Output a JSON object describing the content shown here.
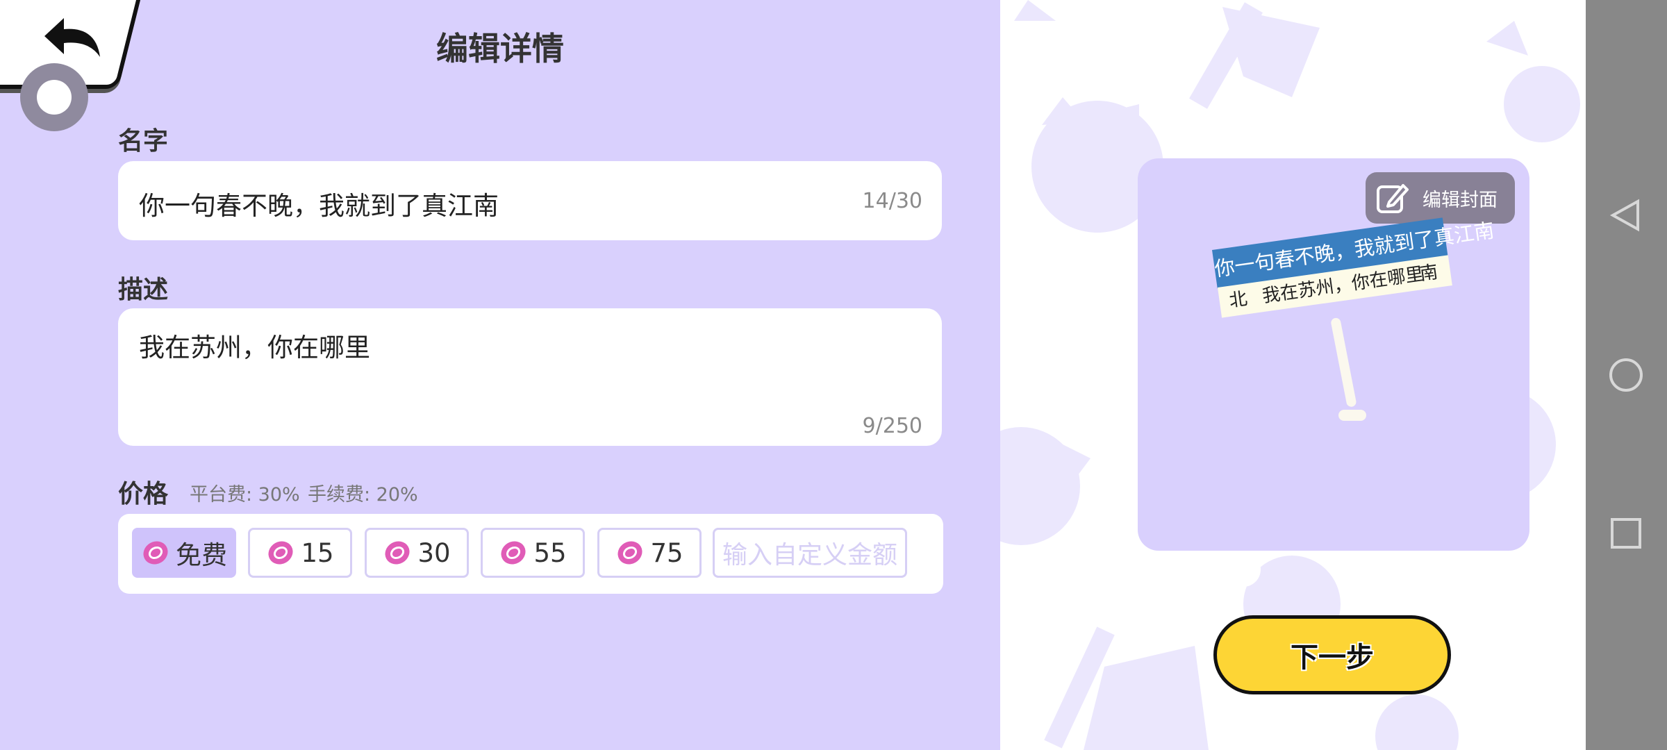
{
  "header": {
    "title": "编辑详情"
  },
  "name_field": {
    "label": "名字",
    "value": "你一句春不晚，我就到了真江南",
    "counter": "14/30"
  },
  "description_field": {
    "label": "描述",
    "value": "我在苏州，你在哪里",
    "counter": "9/250"
  },
  "price": {
    "label": "价格",
    "platform_fee": "平台费: 30%",
    "handling_fee": "手续费: 20%",
    "options": [
      "免费",
      "15",
      "30",
      "55",
      "75"
    ],
    "selected_index": 0,
    "custom_placeholder": "输入自定义金额"
  },
  "cover": {
    "edit_label": "编辑封面",
    "sign_title": "你一句春不晚，我就到了真江南",
    "sign_left": "北",
    "sign_center": "我在苏州，你在哪里",
    "sign_right": "南"
  },
  "next_button": {
    "label": "下一步"
  },
  "colors": {
    "panel_bg": "#d9d0fd",
    "next_button": "#fdd535",
    "sign_blue": "#3a7fc0",
    "selected_option": "#cfc3fb",
    "coin_pink": "#e05cb7"
  },
  "icons": [
    "back-arrow-icon",
    "float-ball-icon",
    "coin-icon",
    "edit-icon",
    "nav-back-icon",
    "nav-home-icon",
    "nav-recents-icon"
  ]
}
